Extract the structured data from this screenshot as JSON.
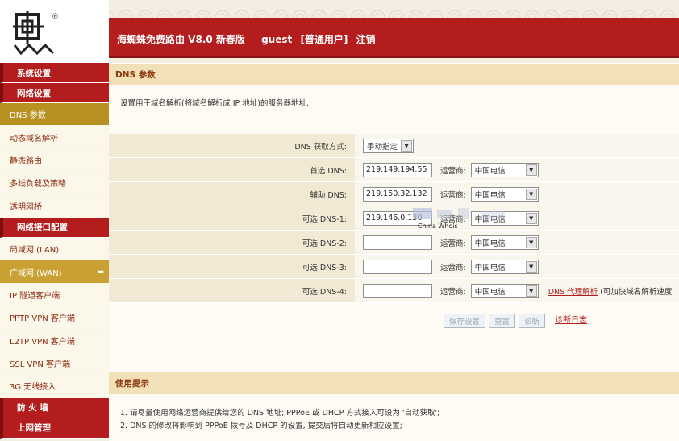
{
  "header": {
    "app_name": "海蜘蛛免费路由 V8.0 新春版",
    "user": "guest",
    "role": "[普通用户]",
    "logout": "注销"
  },
  "logo": {
    "name": "海蜘蛛"
  },
  "sidebar": {
    "groups": [
      {
        "label": "系统设置",
        "items": []
      },
      {
        "label": "网络设置",
        "items": [
          "DNS 参数",
          "动态域名解析",
          "静态路由",
          "多线负载及策略",
          "透明网桥"
        ]
      },
      {
        "label": "网络接口配置",
        "items": [
          "局域网 (LAN)",
          "广域网 (WAN)",
          "IP 隧道客户端",
          "PPTP VPN 客户端",
          "L2TP VPN 客户端",
          "SSL VPN 客户端",
          "3G 无线接入"
        ]
      },
      {
        "label": "防 火 墙",
        "items": []
      },
      {
        "label": "上网管理",
        "items": []
      }
    ],
    "selected": "DNS 参数",
    "highlighted": "广域网 (WAN)"
  },
  "dns": {
    "section_title": "DNS 参数",
    "description": "设置用于域名解析(将域名解析成 IP 地址)的服务器地址.",
    "mode_label": "DNS 获取方式:",
    "mode_value": "手动指定",
    "isp_label": "运营商:",
    "rows": [
      {
        "label": "首选 DNS:",
        "value": "219.149.194.55",
        "isp": "中国电信"
      },
      {
        "label": "辅助 DNS:",
        "value": "219.150.32.132",
        "isp": "中国电信"
      },
      {
        "label": "可选 DNS-1:",
        "value": "219.146.0.130",
        "isp": "中国电信"
      },
      {
        "label": "可选 DNS-2:",
        "value": "",
        "isp": "中国电信"
      },
      {
        "label": "可选 DNS-3:",
        "value": "",
        "isp": "中国电信"
      },
      {
        "label": "可选 DNS-4:",
        "value": "",
        "isp": "中国电信"
      }
    ],
    "proxy_link": "DNS 代理解析",
    "proxy_note": "(可加快域名解析速度",
    "buttons": {
      "save": "保存设置",
      "reset": "重置",
      "diagnose": "诊断"
    },
    "log_link": "诊断日志"
  },
  "tips": {
    "title": "使用提示",
    "lines": [
      "1. 请尽量使用网络运营商提供给您的 DNS 地址; PPPoE 或 DHCP 方式接入可设为 '自动获取';",
      "2. DNS 的修改将影响到 PPPoE 拨号及 DHCP 的设置, 提交后将自动更新相应设置;"
    ]
  },
  "watermark": {
    "text": "China Whois"
  },
  "colors": {
    "header_red": "#b31d1d",
    "sidebar_selected": "#b79222",
    "section_head": "#f1e0b8",
    "link": "#b31d1d"
  }
}
